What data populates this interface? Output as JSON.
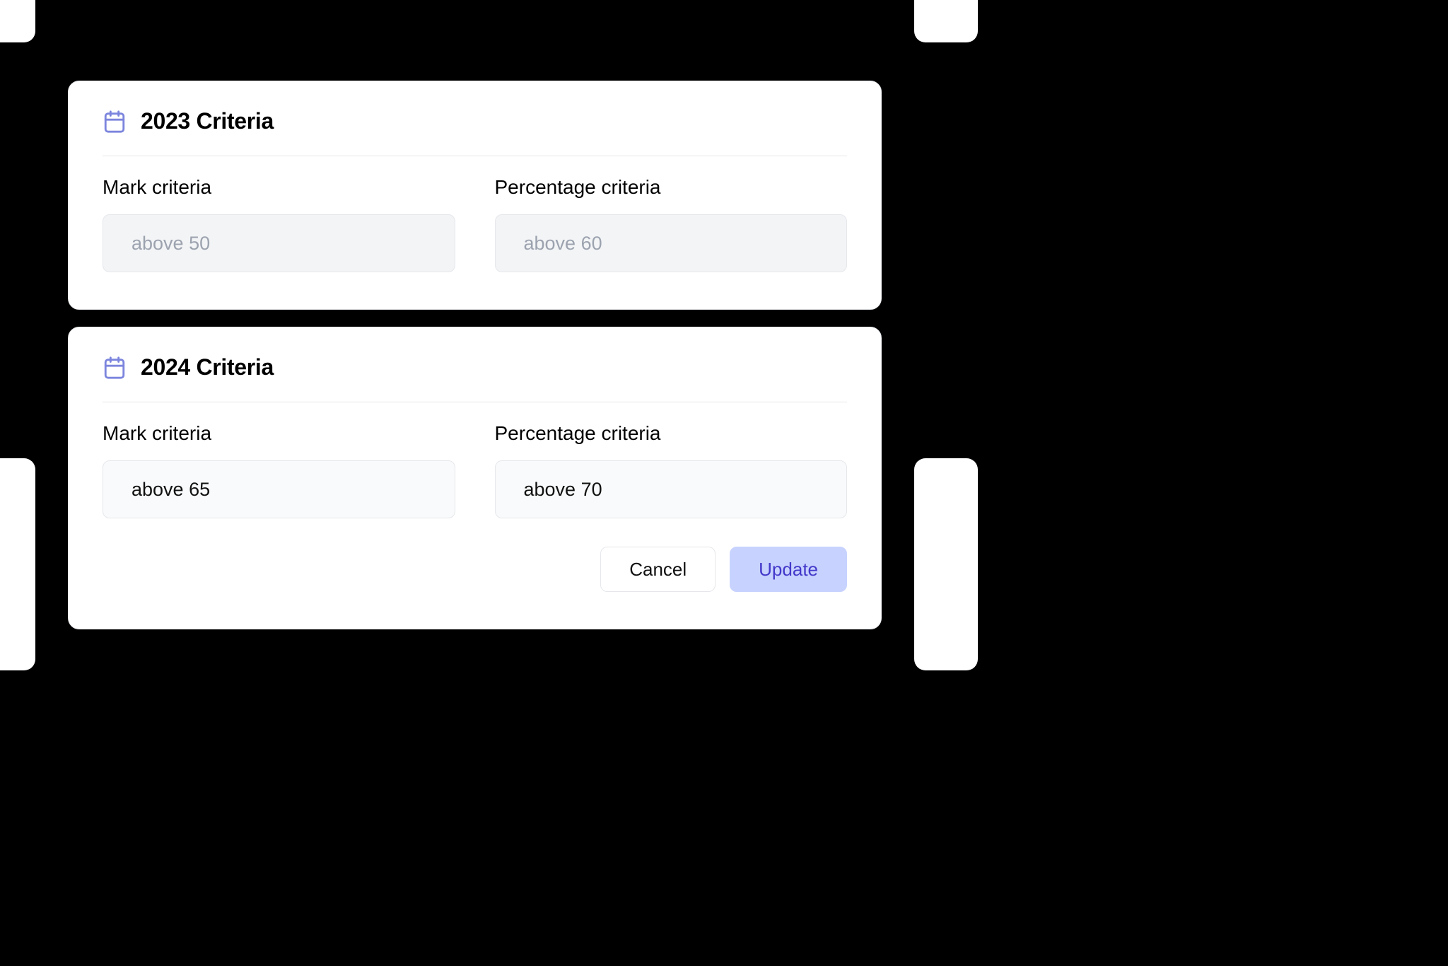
{
  "criteria": [
    {
      "title": "2023 Criteria",
      "editable": false,
      "fields": [
        {
          "label": "Mark criteria",
          "value": "above 50"
        },
        {
          "label": "Percentage criteria",
          "value": "above 60"
        }
      ]
    },
    {
      "title": "2024 Criteria",
      "editable": true,
      "fields": [
        {
          "label": "Mark criteria",
          "value": "above 65"
        },
        {
          "label": "Percentage criteria",
          "value": "above 70"
        }
      ]
    }
  ],
  "buttons": {
    "cancel": "Cancel",
    "update": "Update"
  },
  "colors": {
    "accent": "#7c85dd",
    "primaryBg": "#c7d2fe",
    "primaryText": "#4338ca"
  }
}
